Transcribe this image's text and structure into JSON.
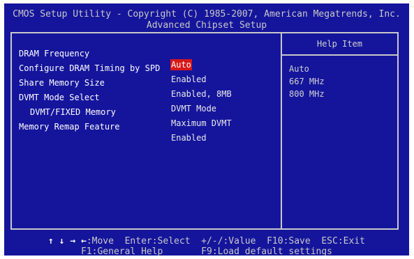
{
  "header": {
    "title_line1": "CMOS Setup Utility - Copyright (C) 1985-2007, American Megatrends, Inc.",
    "title_line2": "Advanced Chipset Setup"
  },
  "settings": [
    {
      "label": "DRAM Frequency",
      "value": "Auto",
      "selected": true
    },
    {
      "label": "Configure DRAM Timing by SPD",
      "value": "Enabled"
    },
    {
      "label": "Share Memory Size",
      "value": "Enabled, 8MB"
    },
    {
      "label": "DVMT Mode Select",
      "value": "DVMT Mode"
    },
    {
      "label": "DVMT/FIXED Memory",
      "value": "Maximum DVMT"
    },
    {
      "label": "Memory Remap Feature",
      "value": "Enabled"
    }
  ],
  "help": {
    "title": "Help Item",
    "options": [
      "Auto",
      "667 MHz",
      "800 MHz"
    ]
  },
  "footer": {
    "arrows": "↑ ↓ → ←",
    "line1_rest": ":Move  Enter:Select  +/-/:Value  F10:Save  ESC:Exit",
    "line2": "F1:General Help       F9:Load default settings"
  },
  "colors": {
    "background": "#15159c",
    "highlight": "#d81818",
    "text": "#ffffff"
  }
}
